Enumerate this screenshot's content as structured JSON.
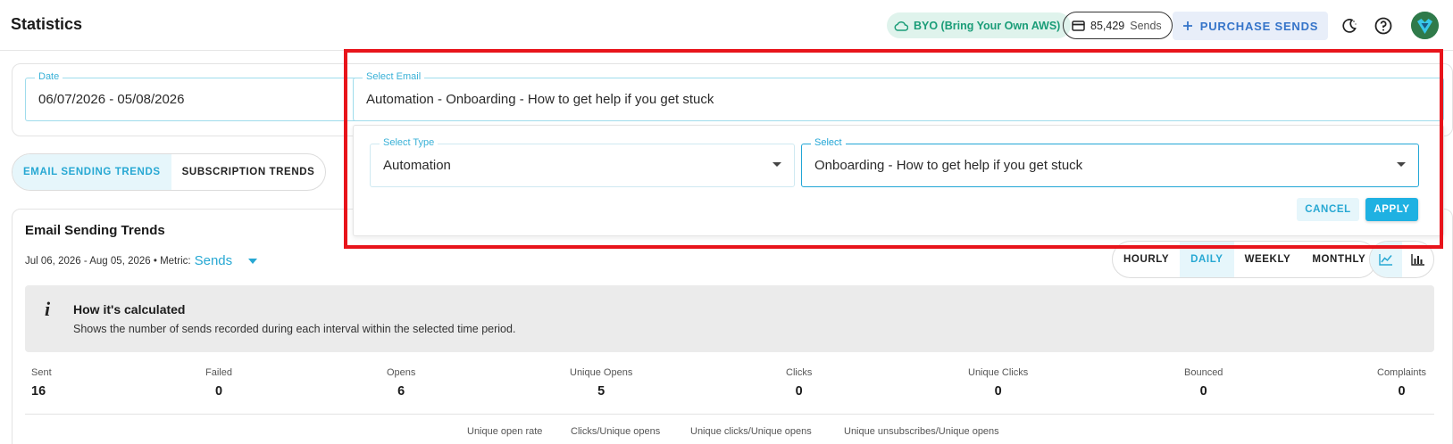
{
  "header": {
    "title": "Statistics",
    "byo_label": "BYO (Bring Your Own AWS)",
    "sends_count": "85,429",
    "sends_word": "Sends",
    "purchase_label": "PURCHASE SENDS"
  },
  "filters": {
    "date_label": "Date",
    "date_value": "06/07/2026 - 05/08/2026",
    "email_label": "Select Email",
    "email_value": "Automation - Onboarding - How to get help if you get stuck"
  },
  "popover": {
    "type_label": "Select Type",
    "type_value": "Automation",
    "select_label": "Select",
    "select_value": "Onboarding - How to get help if you get stuck",
    "cancel_label": "CANCEL",
    "apply_label": "APPLY"
  },
  "tabs": [
    {
      "label": "EMAIL SENDING TRENDS",
      "active": true
    },
    {
      "label": "SUBSCRIPTION TRENDS",
      "active": false
    }
  ],
  "trends": {
    "title": "Email Sending Trends",
    "range": "Jul 06, 2026 - Aug 05, 2026 • Metric:",
    "metric": "Sends",
    "intervals": [
      "HOURLY",
      "DAILY",
      "WEEKLY",
      "MONTHLY"
    ],
    "active_interval": "DAILY",
    "info_title": "How it's calculated",
    "info_text": "Shows the number of sends recorded during each interval within the selected time period."
  },
  "stats": [
    {
      "label": "Sent",
      "value": "16"
    },
    {
      "label": "Failed",
      "value": "0"
    },
    {
      "label": "Opens",
      "value": "6"
    },
    {
      "label": "Unique Opens",
      "value": "5"
    },
    {
      "label": "Clicks",
      "value": "0"
    },
    {
      "label": "Unique Clicks",
      "value": "0"
    },
    {
      "label": "Bounced",
      "value": "0"
    },
    {
      "label": "Complaints",
      "value": "0"
    }
  ],
  "rates": [
    "Unique open rate",
    "Clicks/Unique opens",
    "Unique clicks/Unique opens",
    "Unique unsubscribes/Unique opens"
  ],
  "colors": {
    "accent": "#27a8d3",
    "highlight": "#e8141b",
    "byo": "#1a9d78",
    "purchase": "#3574c9"
  }
}
